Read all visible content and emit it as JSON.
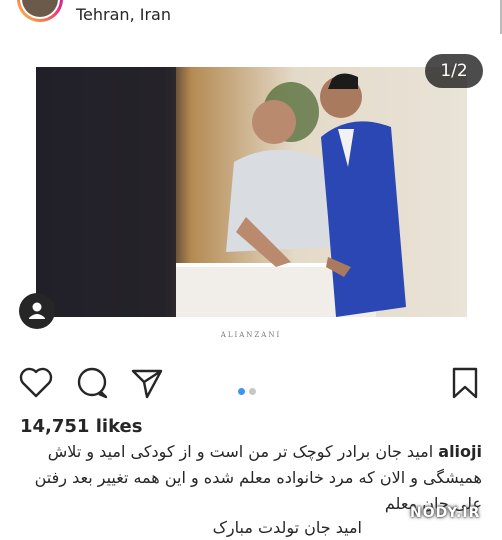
{
  "header": {
    "location": "Tehran, Iran"
  },
  "post": {
    "counter": "1/2",
    "watermark": "ALIANZANI",
    "carousel_pages": 2,
    "carousel_active": 1
  },
  "actions": {
    "like_icon": "heart-icon",
    "comment_icon": "comment-icon",
    "share_icon": "send-icon",
    "save_icon": "bookmark-icon"
  },
  "likes": "14,751 likes",
  "caption": {
    "username": "alioji",
    "line1": "امید جان برادر کوچک تر من است و از کودکی امید و تلاش",
    "line2": "همیشگی و الان که مرد خانواده معلم شده و این همه تغییر بعد رفتن",
    "line3": "علی جان معلم",
    "line4": "امید جان تولدت مبارک"
  },
  "overlay": {
    "site": "NODY.IR"
  },
  "colors": {
    "text": "#262626",
    "active_dot": "#3897f0",
    "inactive_dot": "#c7c7c7"
  }
}
